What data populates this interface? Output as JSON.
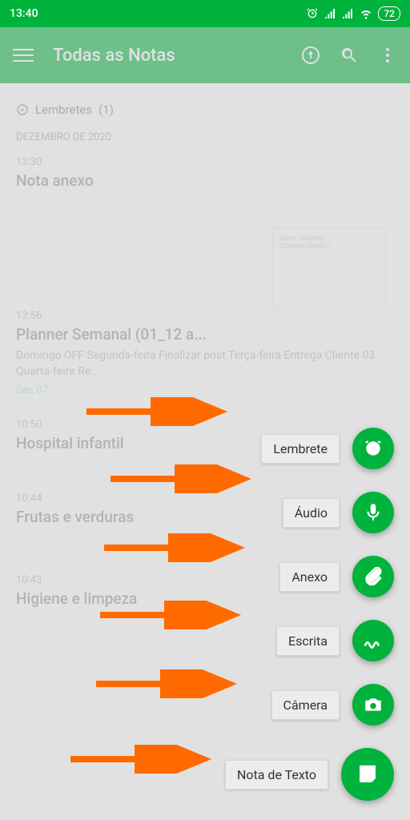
{
  "status": {
    "time": "13:40",
    "battery": "72"
  },
  "header": {
    "title": "Todas as Notas"
  },
  "section": {
    "label": "Lembretes",
    "count": "(1)"
  },
  "month": "DEZEMBRO DE 2020",
  "notes": {
    "n1": {
      "time": "13:30",
      "title": "Nota anexo"
    },
    "n2": {
      "time": "12:56",
      "title": "Planner Semanal (01_12 a...",
      "body": "Domingo OFF Segunda-feira Finalizar post Terça-feira Entrega Cliente 03 Quarta-feira Re...",
      "meta": "Dec 07"
    },
    "n3": {
      "time": "10:50",
      "title": "Hospital infantil"
    },
    "n4": {
      "time": "10:44",
      "title": "Frutas e verduras"
    },
    "n5": {
      "time": "10:43",
      "title": "Higiene e limpeza"
    }
  },
  "fab": {
    "reminder": "Lembrete",
    "audio": "Áudio",
    "attach": "Anexo",
    "writing": "Escrita",
    "camera": "Câmera",
    "text": "Nota de Texto"
  }
}
